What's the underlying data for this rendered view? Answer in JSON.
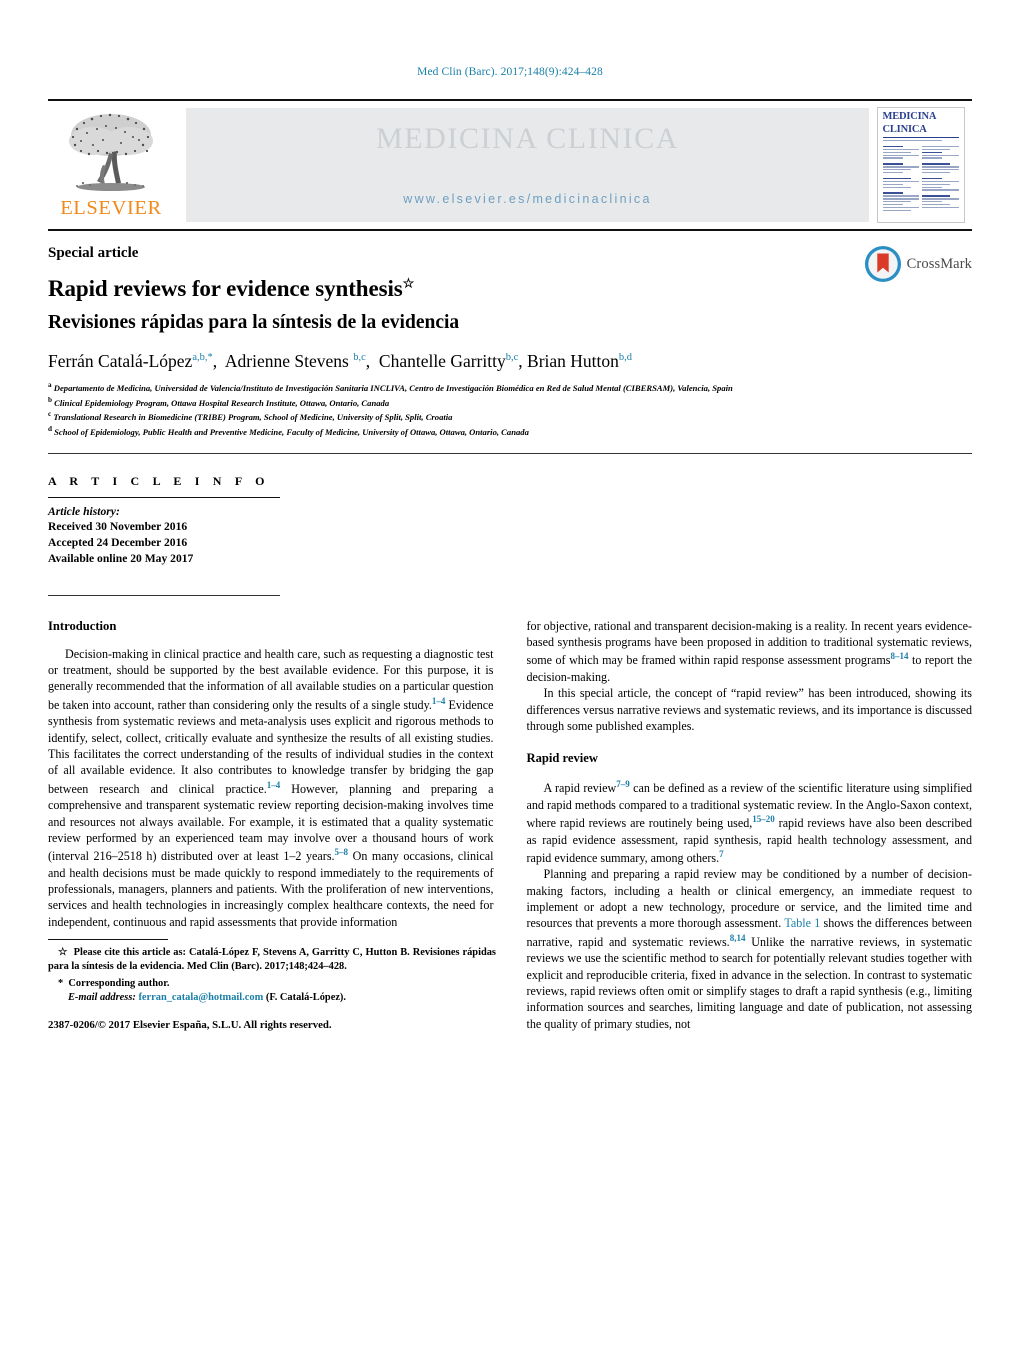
{
  "running_head": "Med Clin (Barc). 2017;148(9):424–428",
  "masthead": {
    "publisher": "ELSEVIER",
    "publisher_logo": "elsevier-tree-logo",
    "journal_name": "MEDICINA CLINICA",
    "journal_url": "www.elsevier.es/medicinaclinica",
    "cover_title_line1": "MEDICINA",
    "cover_title_line2": "CLINICA"
  },
  "article": {
    "kicker": "Special article",
    "title": "Rapid reviews for evidence synthesis",
    "title_marker": "☆",
    "subtitle": "Revisiones rápidas para la síntesis de la evidencia",
    "crossmark_label": "CrossMark",
    "authors": [
      {
        "name": "Ferrán Catalá-López",
        "sup": "a,b,*"
      },
      {
        "name": "Adrienne Stevens",
        "sup": "b,c"
      },
      {
        "name": "Chantelle Garritty",
        "sup": "b,c"
      },
      {
        "name": "Brian Hutton",
        "sup": "b,d"
      }
    ],
    "affiliations": [
      {
        "label": "a",
        "text": "Departamento de Medicina, Universidad de Valencia/Instituto de Investigación Sanitaria INCLIVA, Centro de Investigación Biomédica en Red de Salud Mental (CIBERSAM), Valencia, Spain"
      },
      {
        "label": "b",
        "text": "Clinical Epidemiology Program, Ottawa Hospital Research Institute, Ottawa, Ontario, Canada"
      },
      {
        "label": "c",
        "text": "Translational Research in Biomedicine (TRIBE) Program, School of Medicine, University of Split, Split, Croatia"
      },
      {
        "label": "d",
        "text": "School of Epidemiology, Public Health and Preventive Medicine, Faculty of Medicine, University of Ottawa, Ottawa, Ontario, Canada"
      }
    ]
  },
  "article_info": {
    "heading": "A R T I C L E   I N F O",
    "history_label": "Article history:",
    "received": "Received 30 November 2016",
    "accepted": "Accepted 24 December 2016",
    "available": "Available online 20 May 2017"
  },
  "left_column": {
    "section_heading": "Introduction",
    "paragraph_1": {
      "part_1": "Decision-making in clinical practice and health care, such as requesting a diagnostic test or treatment, should be supported by the best available evidence. For this purpose, it is generally recommended that the information of all available studies on a particular question be taken into account, rather than considering only the results of a single study.",
      "ref_1": "1–4",
      "part_2": " Evidence synthesis from systematic reviews and meta-analysis uses explicit and rigorous methods to identify, select, collect, critically evaluate and synthesize the results of all existing studies. This facilitates the correct understanding of the results of individual studies in the context of all available evidence. It also contributes to knowledge transfer by bridging the gap between research and clinical practice.",
      "ref_2": "1–4",
      "part_3": " However, planning and preparing a comprehensive and transparent systematic review reporting decision-making involves time and resources not always available. For example, it is estimated that a quality systematic review performed by an experienced team may involve over a thousand hours of work (interval 216–2518 h) distributed over at least 1–2 years.",
      "ref_3": "5–8",
      "part_4": " On many occasions, clinical and health decisions must be made quickly to respond immediately to the requirements of professionals, managers, planners and patients. With the proliferation of new interventions, services and health technologies in increasingly complex healthcare contexts, the need for independent, continuous and rapid assessments that provide information"
    }
  },
  "right_column": {
    "paragraph_1": {
      "part_1": "for objective, rational and transparent decision-making is a reality. In recent years evidence-based synthesis programs have been proposed in addition to traditional systematic reviews, some of which may be framed within rapid response assessment programs",
      "ref_1": "8–14",
      "part_2": " to report the decision-making."
    },
    "paragraph_2": "In this special article, the concept of “rapid review” has been introduced, showing its differences versus narrative reviews and systematic reviews, and its importance is discussed through some published examples.",
    "section_heading": "Rapid review",
    "paragraph_3": {
      "part_1": "A rapid review",
      "ref_1": "7–9",
      "part_2": " can be defined as a review of the scientific literature using simplified and rapid methods compared to a traditional systematic review. In the Anglo-Saxon context, where rapid reviews are routinely being used,",
      "ref_2": "15–20",
      "part_3": " rapid reviews have also been described as rapid evidence assessment, rapid synthesis, rapid health technology assessment, and rapid evidence summary, among others.",
      "ref_3": "7"
    },
    "paragraph_4": {
      "part_1": "Planning and preparing a rapid review may be conditioned by a number of decision-making factors, including a health or clinical emergency, an immediate request to implement or adopt a new technology, procedure or service, and the limited time and resources that prevents a more thorough assessment. ",
      "link_1": "Table 1",
      "part_2": " shows the differences between narrative, rapid and systematic reviews.",
      "ref_1": "8,14",
      "part_3": " Unlike the narrative reviews, in systematic reviews we use the scientific method to search for potentially relevant studies together with explicit and reproducible criteria, fixed in advance in the selection. In contrast to systematic reviews, rapid reviews often omit or simplify stages to draft a rapid synthesis (e.g., limiting information sources and searches, limiting language and date of publication, not assessing the quality of primary studies, not"
    }
  },
  "footnotes": {
    "cite_marker": "☆",
    "cite_text": "Please cite this article as: Catalá-López F, Stevens A, Garritty C, Hutton B. Revisiones rápidas para la síntesis de la evidencia. Med Clin (Barc). 2017;148;424–428.",
    "corresponding_marker": "*",
    "corresponding_text": "Corresponding author.",
    "email_label": "E-mail address:",
    "email": "ferran_catala@hotmail.com",
    "email_owner": "(F. Catalá-López).",
    "copyright": "2387-0206/© 2017 Elsevier España, S.L.U. All rights reserved."
  },
  "colors": {
    "accent_blue": "#1a7fa8",
    "elsevier_orange": "#f08a1b",
    "banner_grey": "#e7e9eb",
    "cover_blue": "#2a3f8f"
  }
}
